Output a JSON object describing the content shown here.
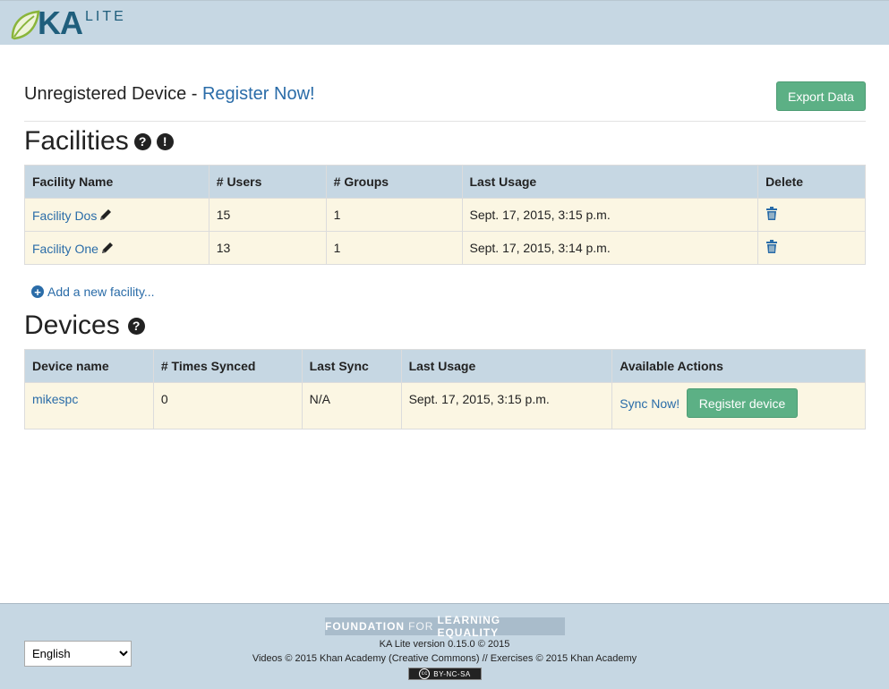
{
  "header": {
    "logo_ka": "KA",
    "logo_lite": "LITE"
  },
  "status": {
    "prefix": "Unregistered Device - ",
    "register_link": "Register Now!"
  },
  "export_button": "Export Data",
  "facilities": {
    "title": "Facilities",
    "help_icon": "question-circle-icon",
    "alert_icon": "exclamation-circle-icon",
    "columns": [
      "Facility Name",
      "# Users",
      "# Groups",
      "Last Usage",
      "Delete"
    ],
    "rows": [
      {
        "name": "Facility Dos",
        "users": "15",
        "groups": "1",
        "last_usage": "Sept. 17, 2015, 3:15 p.m."
      },
      {
        "name": "Facility One",
        "users": "13",
        "groups": "1",
        "last_usage": "Sept. 17, 2015, 3:14 p.m."
      }
    ],
    "add_link": "Add a new facility..."
  },
  "devices": {
    "title": "Devices",
    "help_icon": "question-circle-icon",
    "columns": [
      "Device name",
      "# Times Synced",
      "Last Sync",
      "Last Usage",
      "Available Actions"
    ],
    "rows": [
      {
        "name": "mikespc",
        "times_synced": "0",
        "last_sync": "N/A",
        "last_usage": "Sept. 17, 2015, 3:15 p.m.",
        "sync_link": "Sync Now!",
        "register_button": "Register device"
      }
    ]
  },
  "footer": {
    "language": "English",
    "language_options": [
      "English"
    ],
    "org_part1": "FOUNDATION",
    "org_part2": "FOR",
    "org_part3": "LEARNING EQUALITY",
    "version": "KA Lite version 0.15.0 © 2015",
    "copyright": "Videos © 2015 Khan Academy (Creative Commons) // Exercises © 2015 Khan Academy",
    "license_badge": "BY-NC-SA",
    "license_cc": "cc"
  },
  "colors": {
    "header_bg": "#c6d7e3",
    "row_bg": "#fbf6e3",
    "link": "#2a6ca8",
    "button_green": "#5cb085"
  }
}
